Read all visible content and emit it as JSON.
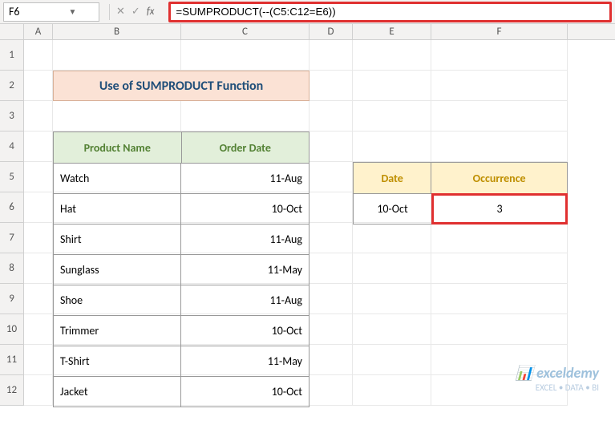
{
  "nameBox": "F6",
  "formula": "=SUMPRODUCT(--(C5:C12=E6))",
  "columns": [
    "A",
    "B",
    "C",
    "D",
    "E",
    "F"
  ],
  "rowNumbers": [
    1,
    2,
    3,
    4,
    5,
    6,
    7,
    8,
    9,
    10,
    11,
    12
  ],
  "title": "Use of SUMPRODUCT Function",
  "table": {
    "headers": [
      "Product Name",
      "Order Date"
    ],
    "rows": [
      {
        "p": "Watch",
        "d": "11-Aug"
      },
      {
        "p": "Hat",
        "d": "10-Oct"
      },
      {
        "p": "Shirt",
        "d": "11-Aug"
      },
      {
        "p": "Sunglass",
        "d": "11-May"
      },
      {
        "p": "Shoe",
        "d": "11-Aug"
      },
      {
        "p": "Trimmer",
        "d": "10-Oct"
      },
      {
        "p": "T-Shirt",
        "d": "11-May"
      },
      {
        "p": "Jacket",
        "d": "10-Oct"
      }
    ]
  },
  "lookup": {
    "headers": [
      "Date",
      "Occurrence"
    ],
    "dateValue": "10-Oct",
    "occurrence": "3"
  },
  "watermark": {
    "brand": "exceldemy",
    "sub": "EXCEL • DATA • BI"
  }
}
